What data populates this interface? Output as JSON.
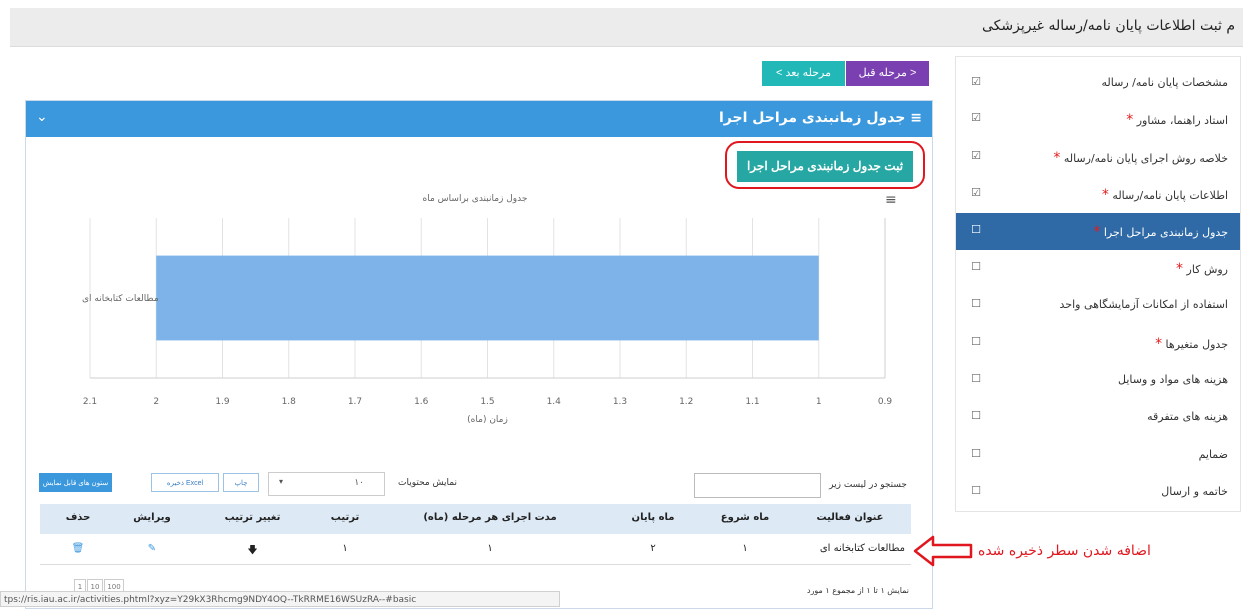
{
  "header": {
    "title": "م ثبت اطلاعات پایان نامه/رساله غیرپزشکی"
  },
  "nav": {
    "prev_label": "< مرحله قبل",
    "next_label": "مرحله بعد >"
  },
  "sidebar": {
    "items": [
      {
        "label": "مشخصات پایان نامه/ رساله",
        "required": false,
        "checked": true,
        "active": false
      },
      {
        "label": "استاد راهنما، مشاور",
        "required": true,
        "checked": true,
        "active": false
      },
      {
        "label": "خلاصه روش اجرای پایان نامه/رساله",
        "required": true,
        "checked": true,
        "active": false
      },
      {
        "label": "اطلاعات پایان نامه/رساله",
        "required": true,
        "checked": true,
        "active": false
      },
      {
        "label": "جدول زمانبندی مراحل اجرا",
        "required": true,
        "checked": false,
        "active": true
      },
      {
        "label": "روش کار",
        "required": true,
        "checked": false,
        "active": false
      },
      {
        "label": "استفاده از امکانات آزمایشگاهی واحد",
        "required": false,
        "checked": false,
        "active": false
      },
      {
        "label": "جدول متغیرها",
        "required": true,
        "checked": false,
        "active": false
      },
      {
        "label": "هزینه های مواد و وسایل",
        "required": false,
        "checked": false,
        "active": false
      },
      {
        "label": "هزینه های متفرقه",
        "required": false,
        "checked": false,
        "active": false
      },
      {
        "label": "ضمایم",
        "required": false,
        "checked": false,
        "active": false
      },
      {
        "label": "خاتمه و ارسال",
        "required": false,
        "checked": false,
        "active": false
      }
    ],
    "star": "*",
    "check_on": "☑",
    "check_off": "☐"
  },
  "panel": {
    "title": "≡ جدول زمانبندی مراحل اجرا",
    "collapse_icon": "chevron-down-icon",
    "collapse_glyph": "⌄"
  },
  "save_button": "ثبت جدول زمانبندی مراحل اجرا",
  "chart_data": {
    "type": "bar",
    "orientation": "horizontal",
    "title": "جدول زمانبندی براساس ماه",
    "xlabel": "(زمان (ماه",
    "categories": [
      "مطالعات کتابخانه ای"
    ],
    "ranges": [
      [
        1,
        2
      ]
    ],
    "xlim": [
      0.9,
      2.1
    ],
    "xaxis_reversed": true,
    "xticks": [
      0.9,
      1,
      1.1,
      1.2,
      1.3,
      1.4,
      1.5,
      1.6,
      1.7,
      1.8,
      1.9,
      2,
      2.1
    ],
    "xtick_labels": [
      "0.9",
      "1",
      "1.1",
      "1.2",
      "1.3",
      "1.4",
      "1.5",
      "1.6",
      "1.7",
      "1.8",
      "1.9",
      "2",
      "2.1"
    ],
    "grid": true,
    "bar_color": "#7db3e8"
  },
  "chart_menu_glyph": "≡",
  "controls": {
    "search_label": "جستجو در لیست زیر",
    "search_value": "",
    "show_label": "نمایش محتویات",
    "show_value": "۱۰",
    "print_label": "چاپ",
    "excel_label": "ذخیره Excel",
    "prev_cols_label": "ستون های قابل نمایش",
    "select_arrow": "▾"
  },
  "table": {
    "headers": [
      "عنوان فعالیت",
      "ماه شروع",
      "ماه پایان",
      "مدت اجرای هر مرحله (ماه)",
      "ترتیب",
      "تغییر ترتیب",
      "ویرایش",
      "حذف"
    ],
    "rows": [
      {
        "title": "مطالعات کتابخانه ای",
        "start": "۱",
        "end": "۲",
        "duration": "۱",
        "order": "۱",
        "move": "🡇",
        "edit": "✎",
        "delete": "🗑"
      }
    ]
  },
  "footer": {
    "info": "نمایش ۱ تا ۱ از مجموع ۱ مورد",
    "pager": [
      "1",
      "10",
      "100"
    ],
    "status_url": "tps://ris.iau.ac.ir/activities.phtml?xyz=Y29kX3Rhcmg9NDY4OQ--TkRRME16WSUzRA--#basic"
  },
  "annotation": {
    "text": "اضافه شدن سطر ذخیره شده",
    "color": "#e0171f"
  }
}
